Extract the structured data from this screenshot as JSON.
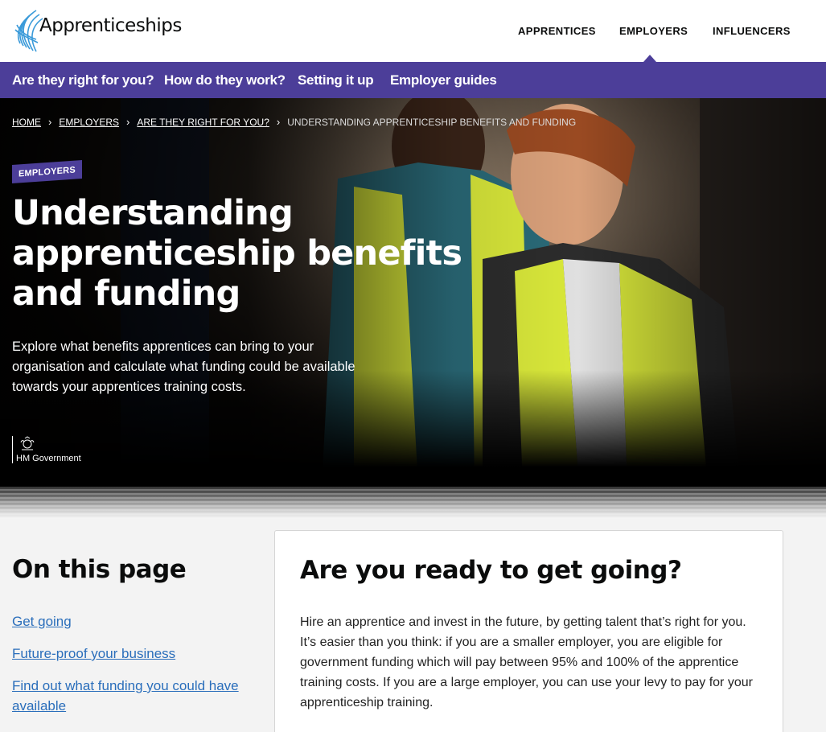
{
  "header": {
    "logo_text": "Apprenticeships",
    "nav": [
      {
        "label": "APPRENTICES"
      },
      {
        "label": "EMPLOYERS"
      },
      {
        "label": "INFLUENCERS"
      }
    ],
    "active_nav": "EMPLOYERS"
  },
  "sub_nav": [
    {
      "label": "Are they right for you?"
    },
    {
      "label": "How do they work?"
    },
    {
      "label": "Setting it up"
    },
    {
      "label": "Employer guides"
    }
  ],
  "breadcrumb": {
    "items": [
      "HOME",
      "EMPLOYERS",
      "ARE THEY RIGHT FOR YOU?"
    ],
    "current": "UNDERSTANDING APPRENTICESHIP BENEFITS AND FUNDING"
  },
  "hero": {
    "tag": "EMPLOYERS",
    "title": "Understanding apprenticeship benefits and funding",
    "lead": "Explore what benefits apprentices can bring to your organisation and calculate what funding could be available towards your apprentices training costs.",
    "gov_label": "HM Government"
  },
  "on_this_page": {
    "title": "On this page",
    "links": [
      "Get going",
      "Future-proof your business",
      "Find out what funding you could have available"
    ]
  },
  "card": {
    "title": "Are you ready to get going?",
    "body": "Hire an apprentice and invest in the future, by getting talent that’s right for you. It’s easier than you think: if you are a smaller employer, you are eligible for government funding which will pay between 95% and 100% of the apprentice training costs. If you are a large employer, you can use your levy to pay for your apprenticeship training."
  },
  "colors": {
    "brand_purple": "#4c3e99",
    "link_blue": "#2a6ebb",
    "logo_blue": "#3a9ad9"
  }
}
